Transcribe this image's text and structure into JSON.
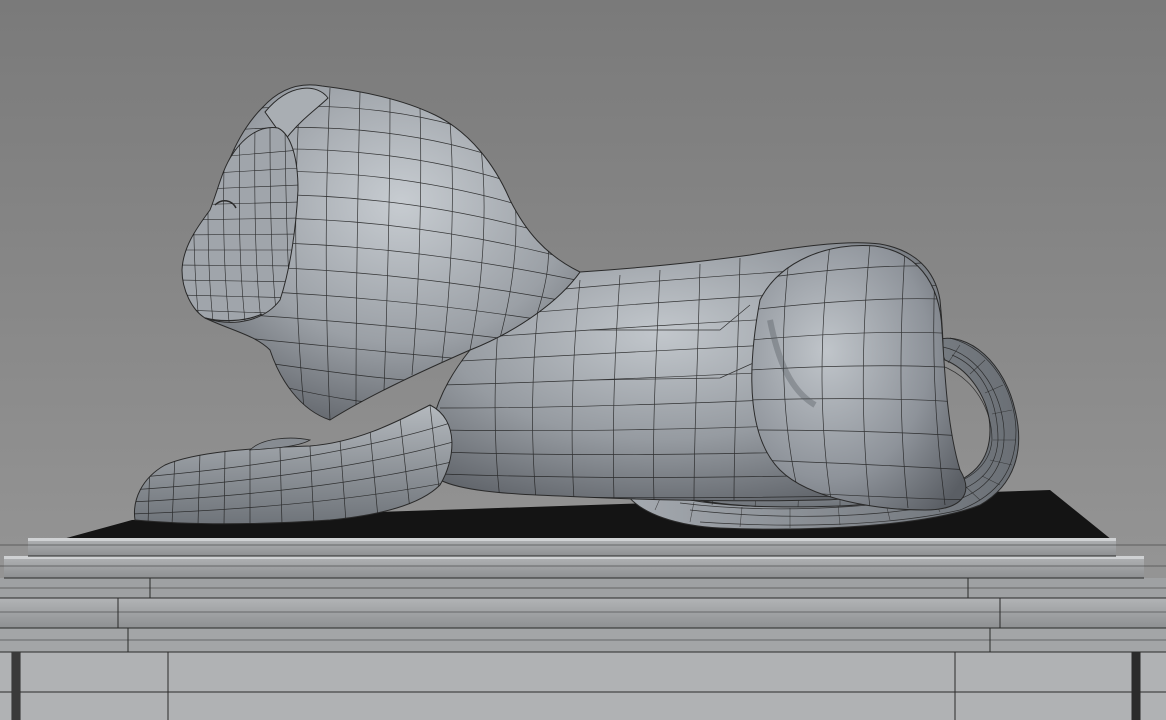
{
  "scene": {
    "subject": "lion-sculpture-wireframe-render",
    "colors": {
      "background_top": "#7b7b7b",
      "background_bottom": "#9a9a9a",
      "clay_light": "#b9bec3",
      "clay_mid": "#8d9298",
      "clay_dark": "#4e5258",
      "wire": "#1c1c1c",
      "pedestal_top": "#151515",
      "pedestal_face": "#a7a9ab",
      "pedestal_edge": "#2a2a2a"
    }
  }
}
